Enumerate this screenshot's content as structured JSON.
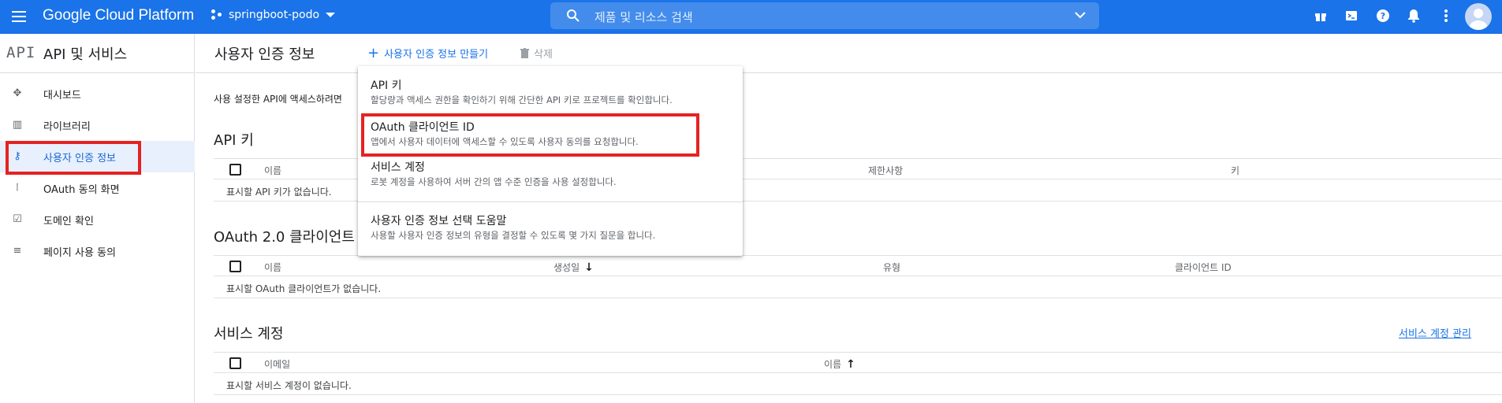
{
  "topbar": {
    "brand": "Google Cloud Platform",
    "project": "springboot-podo",
    "search_placeholder": "제품 및 리소스 검색",
    "icons": [
      "gift-icon",
      "cloud-shell-icon",
      "help-icon",
      "notifications-icon",
      "more-vert-icon",
      "account-avatar"
    ]
  },
  "sidebar": {
    "logo": "API",
    "title": "API 및 서비스",
    "items": [
      {
        "label": "대시보드",
        "icon": "dashboard-icon"
      },
      {
        "label": "라이브러리",
        "icon": "library-icon"
      },
      {
        "label": "사용자 인증 정보",
        "icon": "key-icon",
        "active": true
      },
      {
        "label": "OAuth 동의 화면",
        "icon": "oauth-consent-icon"
      },
      {
        "label": "도메인 확인",
        "icon": "domain-verify-icon"
      },
      {
        "label": "페이지 사용 동의",
        "icon": "page-usage-icon"
      }
    ]
  },
  "header": {
    "title": "사용자 인증 정보",
    "create_label": "사용자 인증 정보 만들기",
    "delete_label": "삭제"
  },
  "main": {
    "description": "사용 설정한 API에 액세스하려면",
    "api_keys": {
      "title": "API 키",
      "columns": [
        "이름",
        "제한사항",
        "키"
      ],
      "empty": "표시할 API 키가 없습니다."
    },
    "oauth": {
      "title": "OAuth 2.0 클라이언트 ID",
      "columns": [
        "이름",
        "생성일",
        "유형",
        "클라이언트 ID"
      ],
      "empty": "표시할 OAuth 클라이언트가 없습니다."
    },
    "service_accounts": {
      "title": "서비스 계정",
      "manage_link": "서비스 계정 관리",
      "columns": [
        "이메일",
        "이름"
      ],
      "empty": "표시할 서비스 계정이 없습니다."
    }
  },
  "dropdown": {
    "items": [
      {
        "title": "API 키",
        "subtitle": "할당량과 액세스 권한을 확인하기 위해 간단한 API 키로 프로젝트를 확인합니다."
      },
      {
        "title": "OAuth 클라이언트 ID",
        "subtitle": "앱에서 사용자 데이터에 액세스할 수 있도록 사용자 동의를 요청합니다."
      },
      {
        "title": "서비스 계정",
        "subtitle": "로봇 계정을 사용하여 서버 간의 앱 수준 인증을 사용 설정합니다."
      },
      {
        "title": "사용자 인증 정보 선택 도움말",
        "subtitle": "사용할 사용자 인증 정보의 유형을 결정할 수 있도록 몇 가지 질문을 합니다."
      }
    ]
  },
  "colors": {
    "topbar": "#1a73e8",
    "active_nav_bg": "#e8f0fe",
    "link": "#1a73e8",
    "highlight_box": "#e52222"
  }
}
